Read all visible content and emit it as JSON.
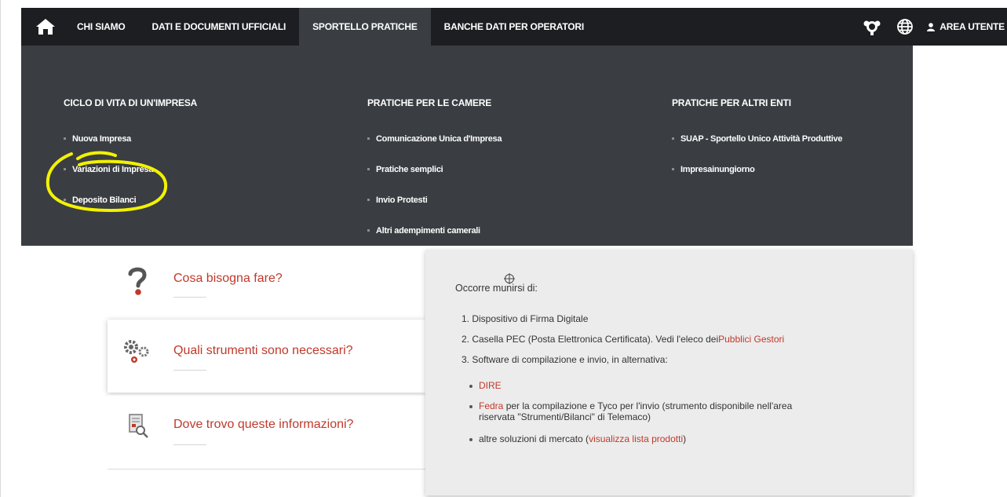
{
  "navbar": {
    "items": [
      {
        "label": "CHI SIAMO"
      },
      {
        "label": "DATI E DOCUMENTI UFFICIALI"
      },
      {
        "label": "SPORTELLO PRATICHE"
      },
      {
        "label": "BANCHE DATI PER OPERATORI"
      }
    ],
    "area_label": "AREA UTENTE"
  },
  "mega_menu": {
    "columns": [
      {
        "title": "CICLO DI VITA DI UN'IMPRESA",
        "items": [
          "Nuova Impresa",
          "Variazioni di Impresa",
          "Deposito Bilanci"
        ]
      },
      {
        "title": "PRATICHE PER LE CAMERE",
        "items": [
          "Comunicazione Unica d'Impresa",
          "Pratiche semplici",
          "Invio Protesti",
          "Altri adempimenti camerali"
        ]
      },
      {
        "title": "PRATICHE PER ALTRI ENTI",
        "items": [
          "SUAP - Sportello Unico Attività Produttive",
          "Impresainungiorno"
        ]
      }
    ]
  },
  "accordion": {
    "items": [
      {
        "label": "Cosa bisogna fare?",
        "icon": "question-icon"
      },
      {
        "label": "Quali strumenti sono necessari?",
        "icon": "gears-icon"
      },
      {
        "label": "Dove trovo queste informazioni?",
        "icon": "documents-search-icon"
      }
    ]
  },
  "panel": {
    "intro_a": "Occorre muni",
    "intro_b": "rsi di:",
    "list": {
      "item1": "1. Dispositivo di Firma Digitale",
      "item2_text": "2. Casella PEC (Posta Elettronica Certificata). Vedi l'eleco dei ",
      "item2_link": "Pubblici Gestori",
      "item3": "3. Software di compilazione e invio, in alternativa:"
    },
    "sub": {
      "dire": "DIRE",
      "fedra_link": "Fedra",
      "fedra_text_1": " per la compilazione e Tyco per l'invio (strumento disponibile nell'area",
      "fedra_text_2": "riservata \"Strumenti/Bilanci\" di Telemaco)",
      "altre_text": "altre soluzioni di mercato (",
      "altre_link": "visualizza lista prodotti",
      "altre_close": ")"
    }
  },
  "colors": {
    "nav_bg": "#1c1e21",
    "menu_bg": "#3a3d42",
    "accent_red": "#c0392b",
    "annotation_yellow": "#f2f200",
    "panel_bg": "#ececec"
  }
}
